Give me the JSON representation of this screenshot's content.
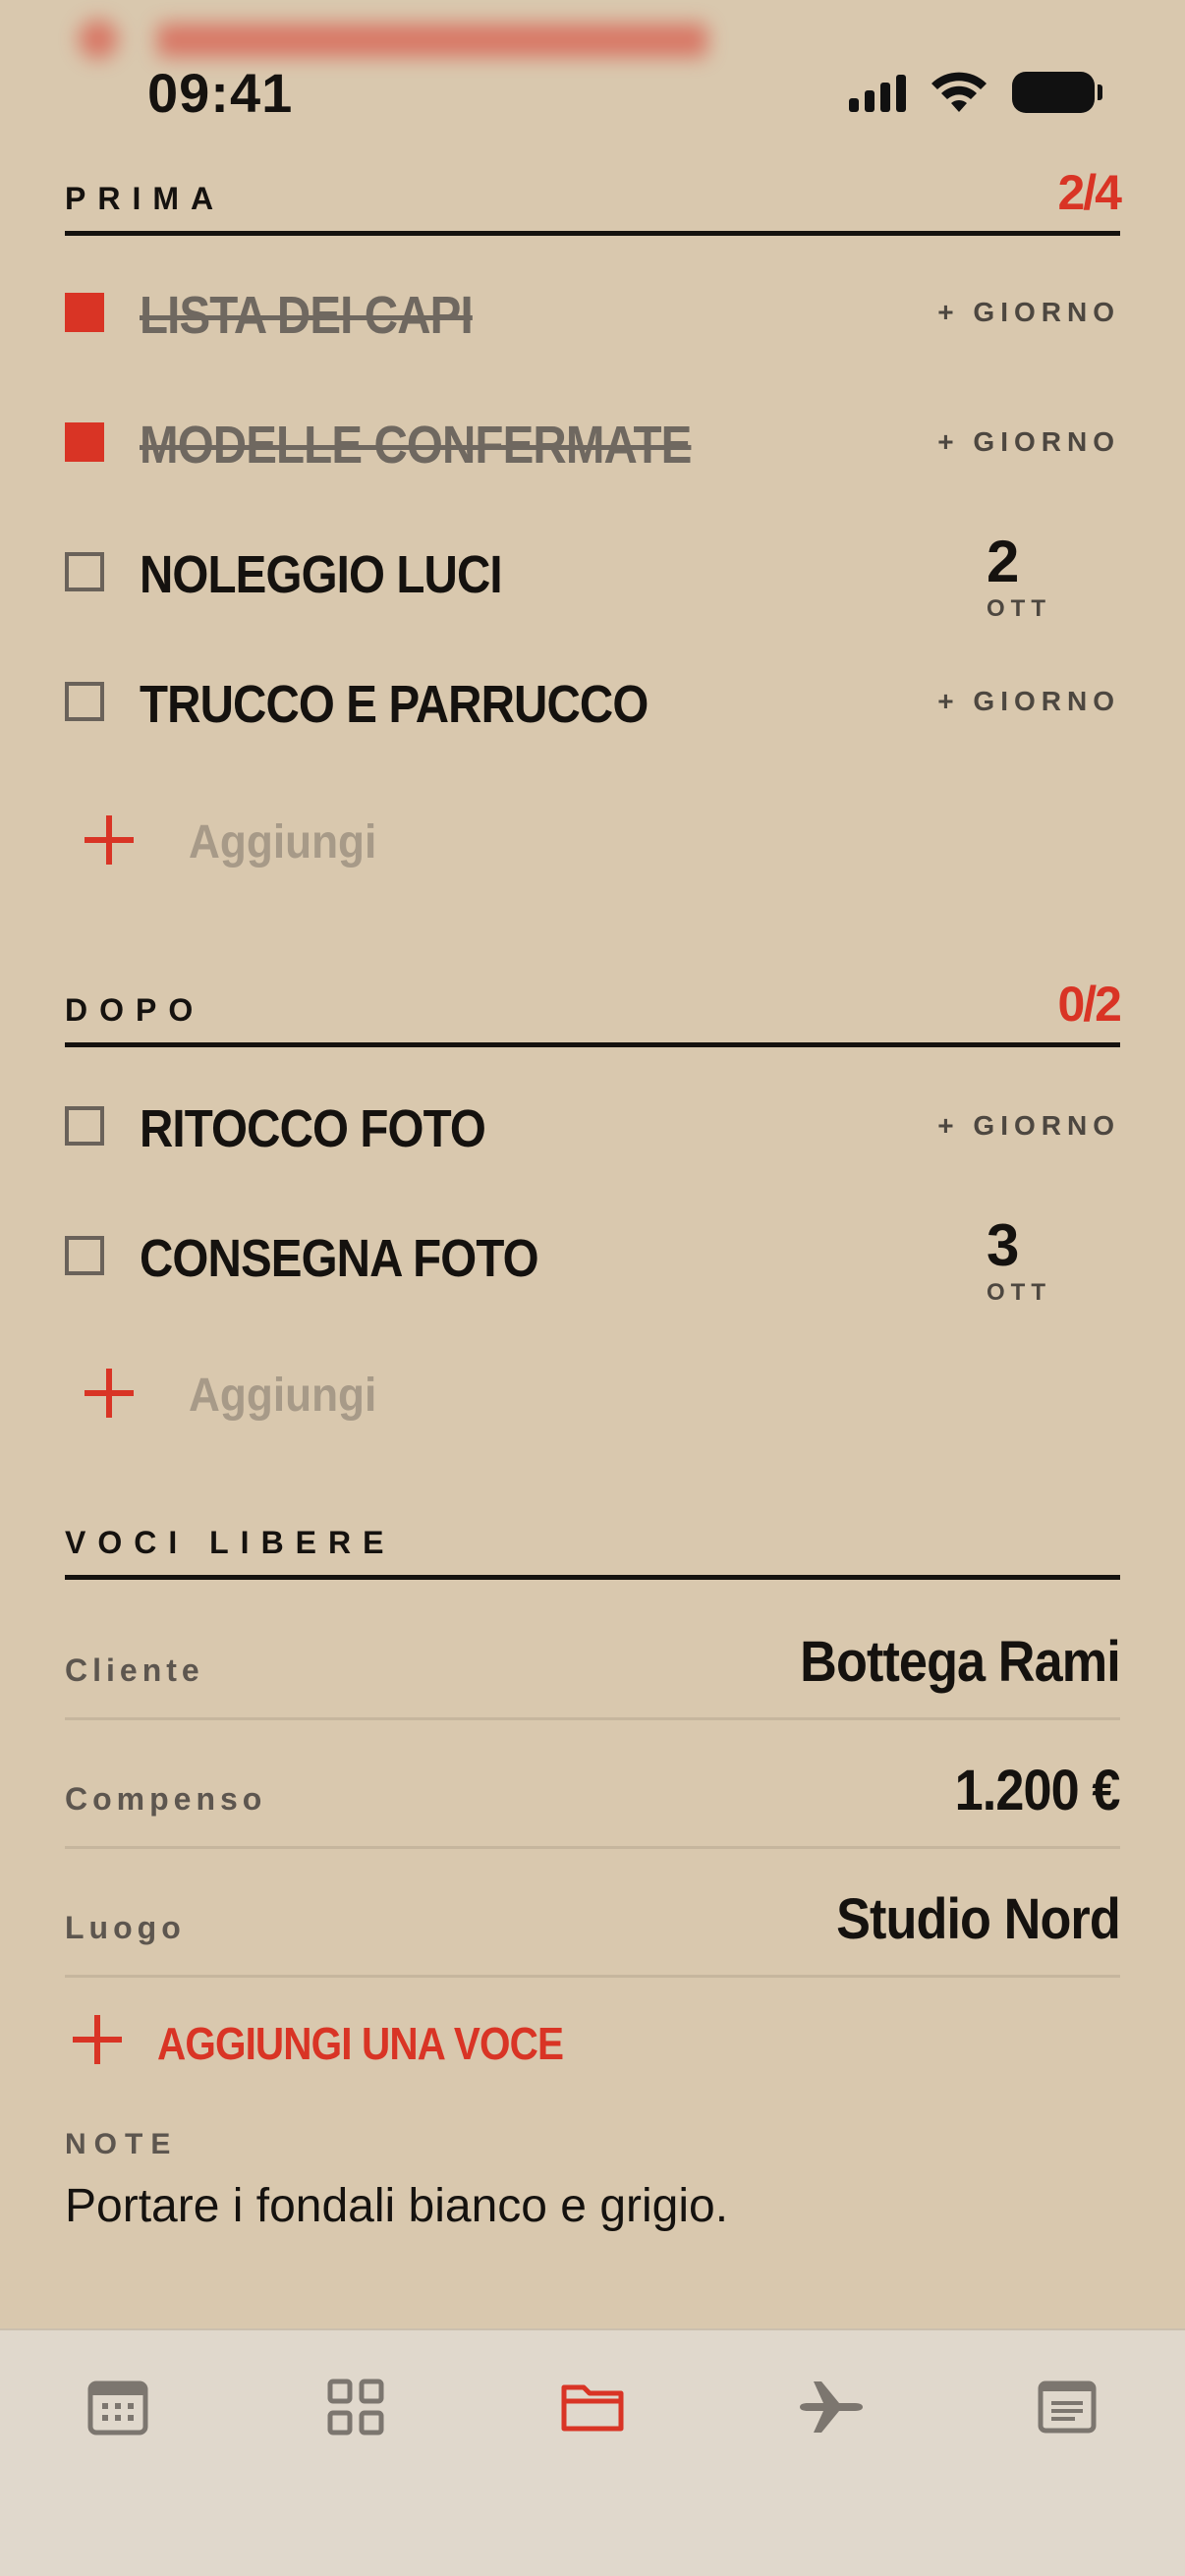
{
  "status_bar": {
    "time": "09:41"
  },
  "sections": {
    "prima": {
      "title": "PRIMA",
      "count": "2/4",
      "tasks": [
        {
          "label": "LISTA DEI CAPI",
          "done": true,
          "day_action": "+ GIORNO"
        },
        {
          "label": "MODELLE CONFERMATE",
          "done": true,
          "day_action": "+ GIORNO"
        },
        {
          "label": "NOLEGGIO LUCI",
          "done": false,
          "date_day": "2",
          "date_month": "OTT"
        },
        {
          "label": "TRUCCO E PARRUCCO",
          "done": false,
          "day_action": "+ GIORNO"
        }
      ],
      "add_label": "Aggiungi"
    },
    "dopo": {
      "title": "DOPO",
      "count": "0/2",
      "tasks": [
        {
          "label": "RITOCCO FOTO",
          "done": false,
          "day_action": "+ GIORNO"
        },
        {
          "label": "CONSEGNA FOTO",
          "done": false,
          "date_day": "3",
          "date_month": "OTT"
        }
      ],
      "add_label": "Aggiungi"
    },
    "voci_libere": {
      "title": "VOCI LIBERE",
      "entries": [
        {
          "key": "Cliente",
          "value": "Bottega Rami"
        },
        {
          "key": "Compenso",
          "value": "1.200 €"
        },
        {
          "key": "Luogo",
          "value": "Studio Nord"
        }
      ],
      "add_label": "AGGIUNGI UNA VOCE"
    }
  },
  "notes": {
    "title": "NOTE",
    "text": "Portare i fondali bianco e grigio."
  },
  "tab_bar": {
    "items": [
      {
        "icon": "calendar-icon",
        "active": false
      },
      {
        "icon": "grid-icon",
        "active": false
      },
      {
        "icon": "folder-icon",
        "active": true
      },
      {
        "icon": "airplane-icon",
        "active": false
      },
      {
        "icon": "notes-icon",
        "active": false
      }
    ]
  },
  "colors": {
    "background": "#d9c8ae",
    "accent": "#d93425",
    "text": "#15120f",
    "muted": "#a79a88"
  }
}
